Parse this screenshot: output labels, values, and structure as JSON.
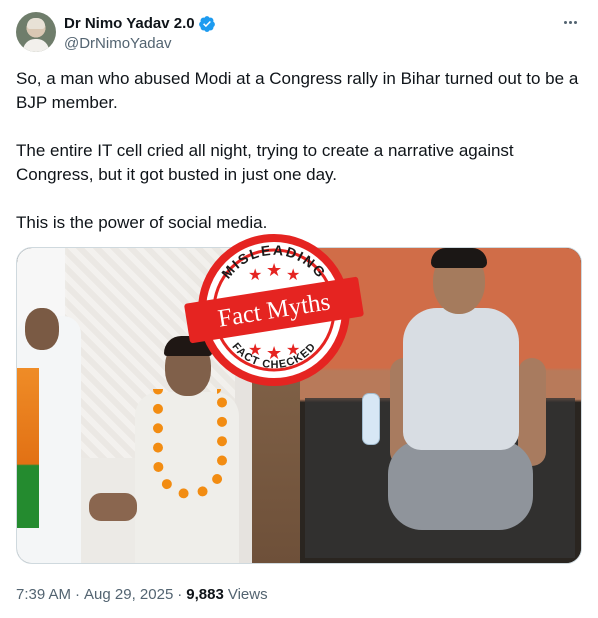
{
  "author": {
    "name": "Dr Nimo Yadav 2.0",
    "handle": "@DrNimoYadav",
    "verified": true
  },
  "tweet": {
    "paragraphs": [
      "So, a man who abused Modi at a Congress rally in Bihar turned out to be a BJP member.",
      "The entire IT cell cried all night, trying to create a narrative against Congress, but it got busted in just one day.",
      "This is the power of social media."
    ]
  },
  "media": {
    "badge": {
      "top_text": "MISLEADING",
      "title": "Fact Myths",
      "bottom_text": "FACT CHECKED"
    },
    "bottle_label": ""
  },
  "footer": {
    "time": "7:39 AM",
    "separator": "·",
    "date": "Aug 29, 2025",
    "views_count": "9,883",
    "views_label": "Views"
  },
  "colors": {
    "brand_red": "#e52421",
    "verified_blue": "#1d9bf0",
    "text_primary": "#0f1419",
    "text_secondary": "#536471"
  }
}
